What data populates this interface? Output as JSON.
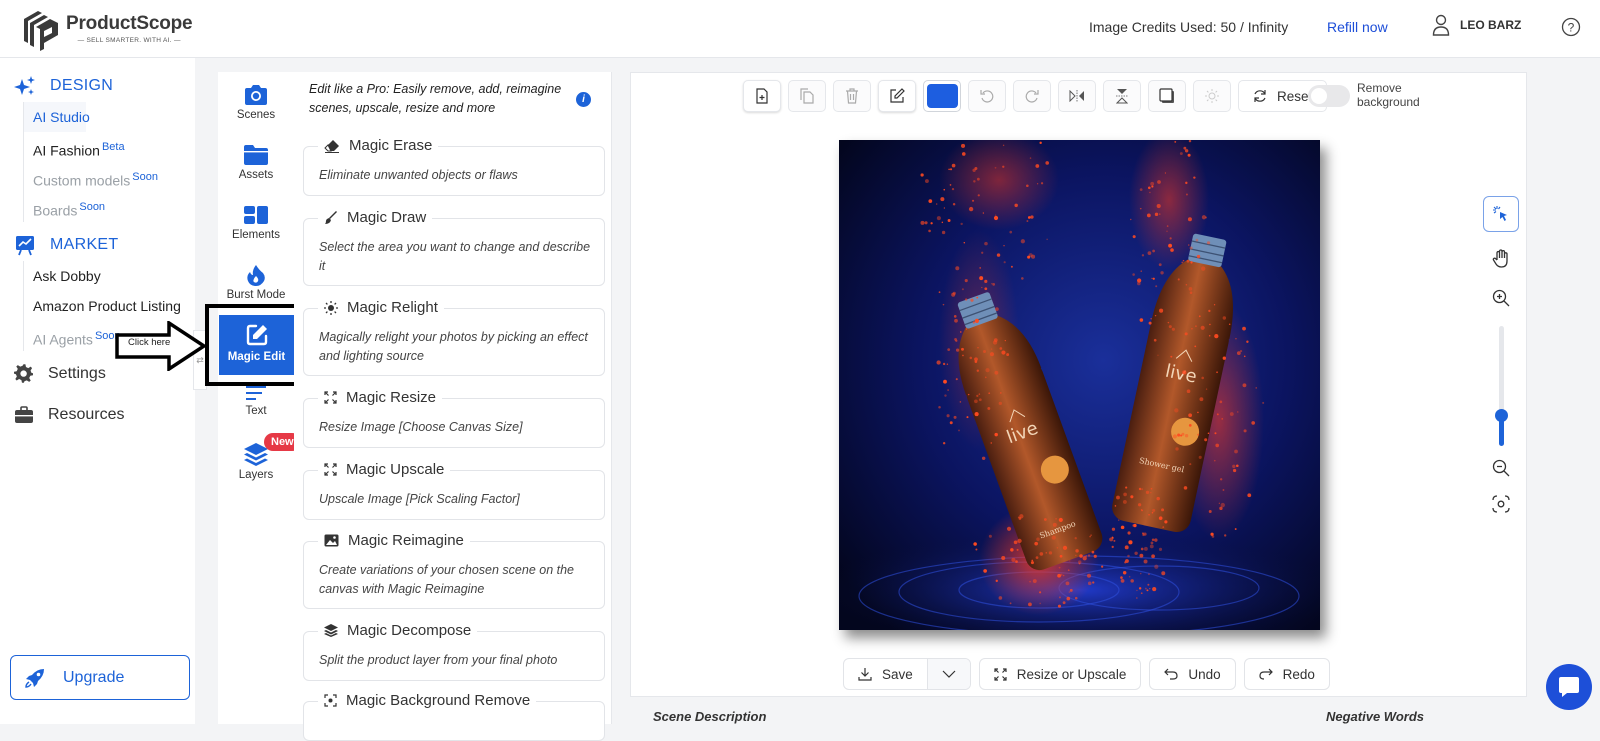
{
  "header": {
    "brand_name": "ProductScope",
    "brand_tagline": "— SELL SMARTER. WITH AI. —",
    "credits_text": "Image Credits Used: 50 / Infinity",
    "refill_label": "Refill now",
    "user_name": "LEO BARZ",
    "user_icon": "user-icon",
    "help_icon": "help-circle-icon"
  },
  "sidebar": {
    "design": {
      "label": "DESIGN",
      "icon": "sparkles-icon",
      "items": [
        {
          "label": "AI Studio",
          "badge": "",
          "state": "active"
        },
        {
          "label": "AI Fashion",
          "badge": "Beta",
          "state": "normal"
        },
        {
          "label": "Custom models",
          "badge": "Soon",
          "state": "disabled"
        },
        {
          "label": "Boards",
          "badge": "Soon",
          "state": "disabled"
        }
      ]
    },
    "market": {
      "label": "MARKET",
      "icon": "chart-board-icon",
      "items": [
        {
          "label": "Ask Dobby",
          "badge": "",
          "state": "normal"
        },
        {
          "label": "Amazon Product Listing",
          "badge": "",
          "state": "normal"
        },
        {
          "label": "AI Agents",
          "badge": "Soon",
          "state": "disabled"
        }
      ]
    },
    "settings_label": "Settings",
    "resources_label": "Resources",
    "upgrade_label": "Upgrade"
  },
  "callout": {
    "text": "Click here"
  },
  "tool_rail": {
    "items": [
      {
        "label": "Scenes",
        "icon": "camera-icon"
      },
      {
        "label": "Assets",
        "icon": "folder-icon"
      },
      {
        "label": "Elements",
        "icon": "elements-icon"
      },
      {
        "label": "Burst Mode",
        "icon": "flame-icon"
      },
      {
        "label": "Magic Edit",
        "icon": "edit-icon",
        "active": true
      },
      {
        "label": "Text",
        "icon": "text-lines-icon"
      },
      {
        "label": "Layers",
        "icon": "layers-icon",
        "badge": "New"
      }
    ]
  },
  "tools_panel": {
    "intro": "Edit like a Pro: Easily remove, add, reimagine scenes, upscale, resize and more",
    "info_icon": "i",
    "cards": [
      {
        "title": "Magic Erase",
        "icon": "eraser-icon",
        "desc": "Eliminate unwanted objects or flaws"
      },
      {
        "title": "Magic Draw",
        "icon": "brush-icon",
        "desc": "Select the area you want to change and describe it"
      },
      {
        "title": "Magic Relight",
        "icon": "sun-icon",
        "desc": "Magically relight your photos by picking an effect and lighting source"
      },
      {
        "title": "Magic Resize",
        "icon": "expand-icon",
        "desc": "Resize Image [Choose Canvas Size]"
      },
      {
        "title": "Magic Upscale",
        "icon": "expand-icon",
        "desc": "Upscale Image [Pick Scaling Factor]"
      },
      {
        "title": "Magic Reimagine",
        "icon": "image-icon",
        "desc": "Create variations of your chosen scene on the canvas with Magic Reimagine"
      },
      {
        "title": "Magic Decompose",
        "icon": "layers-icon",
        "desc": "Split the product layer from your final photo"
      },
      {
        "title": "Magic Background Remove",
        "icon": "focus-icon",
        "desc": ""
      }
    ]
  },
  "canvas": {
    "toolbar": {
      "reset_label": "Reset",
      "fill_color": "#1d5ee0",
      "remove_bg_label": "Remove background",
      "remove_bg_enabled": false
    },
    "zoom_level_fraction": 0.25,
    "photo_alt": "Two amber 'live' bottles splashing in water with red particles on dark blue background",
    "actions": {
      "save_label": "Save",
      "resize_label": "Resize or Upscale",
      "undo_label": "Undo",
      "redo_label": "Redo"
    }
  },
  "form": {
    "scene_description_label": "Scene Description",
    "negative_words_label": "Negative Words"
  }
}
